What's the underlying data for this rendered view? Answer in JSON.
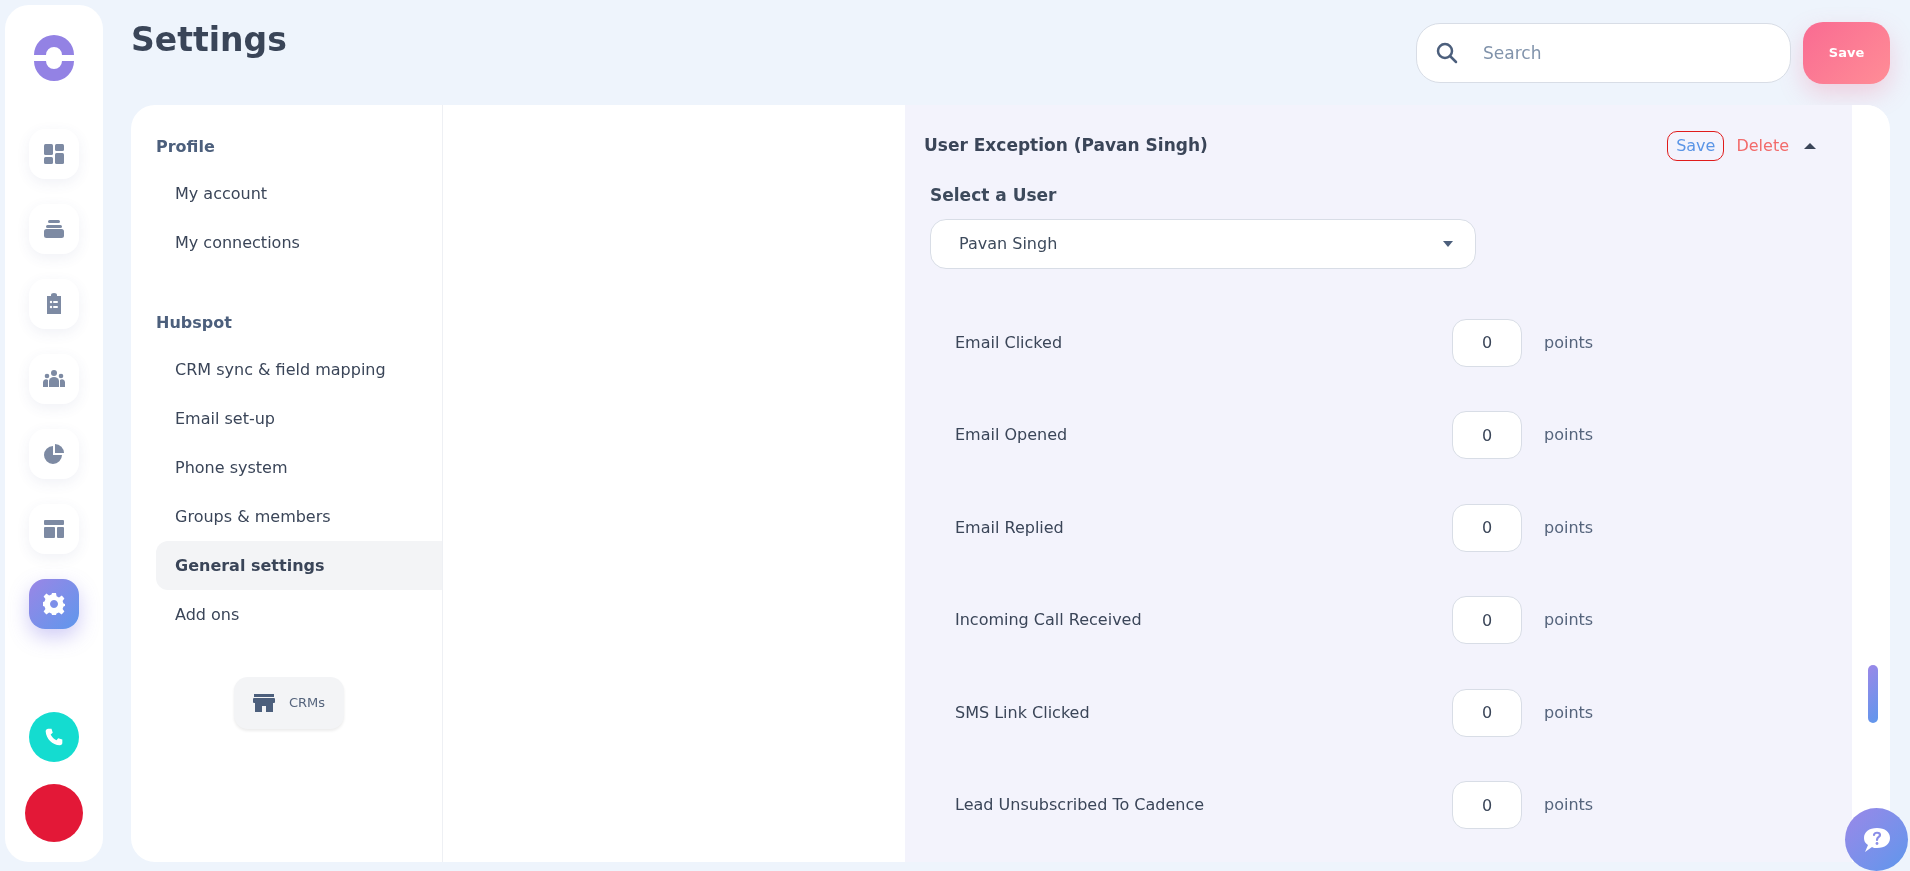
{
  "rail": {
    "items": [
      {
        "kind": "dashboard",
        "selected": false
      },
      {
        "kind": "inbox",
        "selected": false
      },
      {
        "kind": "clipboard",
        "selected": false
      },
      {
        "kind": "people",
        "selected": false
      },
      {
        "kind": "pie",
        "selected": false
      },
      {
        "kind": "layout",
        "selected": false
      },
      {
        "kind": "gear",
        "selected": true
      }
    ]
  },
  "header": {
    "title": "Settings",
    "search": {
      "placeholder": "Search"
    },
    "save_button": "Save"
  },
  "nav": {
    "sections": [
      {
        "heading": "Profile",
        "items": [
          {
            "label": "My account",
            "selected": false
          },
          {
            "label": "My connections",
            "selected": false
          }
        ]
      },
      {
        "heading": "Hubspot",
        "items": [
          {
            "label": "CRM sync & field mapping",
            "selected": false
          },
          {
            "label": "Email set-up",
            "selected": false
          },
          {
            "label": "Phone system",
            "selected": false
          },
          {
            "label": "Groups & members",
            "selected": false
          },
          {
            "label": "General settings",
            "selected": true
          },
          {
            "label": "Add ons",
            "selected": false
          }
        ]
      }
    ],
    "crms_button": "CRMs"
  },
  "panel": {
    "title": "User Exception (Pavan Singh)",
    "save": "Save",
    "delete": "Delete",
    "expanded": true,
    "select_label": "Select a User",
    "select_value": "Pavan Singh",
    "rows": [
      {
        "label": "Email Clicked",
        "value": "0",
        "unit": "points"
      },
      {
        "label": "Email Opened",
        "value": "0",
        "unit": "points"
      },
      {
        "label": "Email Replied",
        "value": "0",
        "unit": "points"
      },
      {
        "label": "Incoming Call Received",
        "value": "0",
        "unit": "points"
      },
      {
        "label": "SMS Link Clicked",
        "value": "0",
        "unit": "points"
      },
      {
        "label": "Lead Unsubscribed To Cadence",
        "value": "0",
        "unit": "points"
      }
    ]
  }
}
